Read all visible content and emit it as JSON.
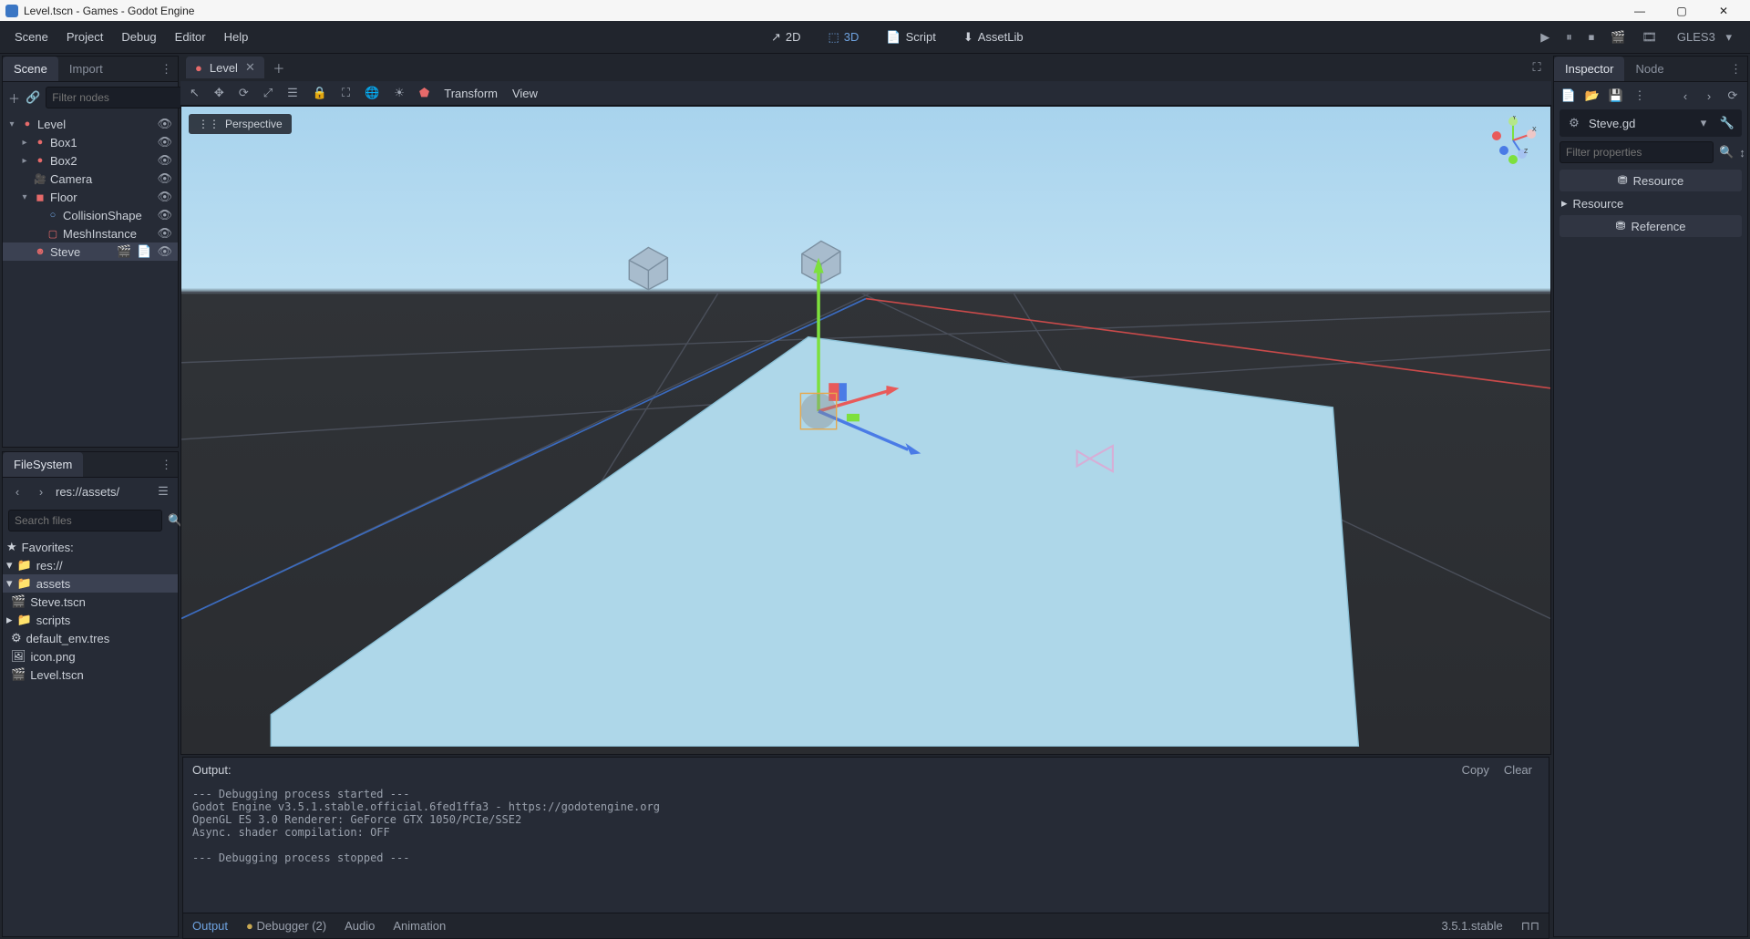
{
  "window": {
    "title": "Level.tscn - Games - Godot Engine"
  },
  "menubar": {
    "items": [
      "Scene",
      "Project",
      "Debug",
      "Editor",
      "Help"
    ],
    "modes": {
      "d2": "2D",
      "d3": "3D",
      "script": "Script",
      "assetlib": "AssetLib"
    },
    "renderer": "GLES3"
  },
  "scene_dock": {
    "tabs": [
      "Scene",
      "Import"
    ],
    "filter_placeholder": "Filter nodes",
    "tree": [
      {
        "label": "Level",
        "depth": 0,
        "icon": "●",
        "color": "nodecolor-red",
        "expand": "▾"
      },
      {
        "label": "Box1",
        "depth": 1,
        "icon": "●",
        "color": "nodecolor-red",
        "expand": "▸"
      },
      {
        "label": "Box2",
        "depth": 1,
        "icon": "●",
        "color": "nodecolor-red",
        "expand": "▸"
      },
      {
        "label": "Camera",
        "depth": 1,
        "icon": "🎥",
        "color": "nodecolor-scene",
        "expand": ""
      },
      {
        "label": "Floor",
        "depth": 1,
        "icon": "◼",
        "color": "nodecolor-red",
        "expand": "▾"
      },
      {
        "label": "CollisionShape",
        "depth": 2,
        "icon": "○",
        "color": "nodecolor-blue",
        "expand": ""
      },
      {
        "label": "MeshInstance",
        "depth": 2,
        "icon": "▢",
        "color": "nodecolor-scene",
        "expand": ""
      },
      {
        "label": "Steve",
        "depth": 1,
        "icon": "☻",
        "color": "nodecolor-scene",
        "expand": "",
        "selected": true,
        "extras": true
      }
    ]
  },
  "filesystem": {
    "title": "FileSystem",
    "path": "res://assets/",
    "search_placeholder": "Search files",
    "favorites": "Favorites:",
    "items": [
      {
        "label": "res://",
        "depth": 0,
        "icon": "folder",
        "expand": "▾"
      },
      {
        "label": "assets",
        "depth": 1,
        "icon": "folder",
        "expand": "▾",
        "selected": true
      },
      {
        "label": "Steve.tscn",
        "depth": 2,
        "icon": "scene",
        "expand": ""
      },
      {
        "label": "scripts",
        "depth": 1,
        "icon": "folder",
        "expand": "▸"
      },
      {
        "label": "default_env.tres",
        "depth": 1,
        "icon": "res",
        "expand": ""
      },
      {
        "label": "icon.png",
        "depth": 1,
        "icon": "img",
        "expand": ""
      },
      {
        "label": "Level.tscn",
        "depth": 1,
        "icon": "scene",
        "expand": ""
      }
    ]
  },
  "scene_tabs": {
    "current": "Level"
  },
  "viewport_toolbar": {
    "transform": "Transform",
    "view": "View",
    "perspective": "Perspective"
  },
  "bottom_panel": {
    "output_label": "Output:",
    "copy": "Copy",
    "clear": "Clear",
    "log": "--- Debugging process started ---\nGodot Engine v3.5.1.stable.official.6fed1ffa3 - https://godotengine.org\nOpenGL ES 3.0 Renderer: GeForce GTX 1050/PCIe/SSE2\nAsync. shader compilation: OFF\n \n--- Debugging process stopped ---",
    "tabs": {
      "output": "Output",
      "debugger": "Debugger (2)",
      "audio": "Audio",
      "animation": "Animation"
    },
    "version": "3.5.1.stable"
  },
  "inspector": {
    "tabs": [
      "Inspector",
      "Node"
    ],
    "object": "Steve.gd",
    "filter_placeholder": "Filter properties",
    "sections": {
      "resource_hdr": "Resource",
      "resource_sub": "Resource",
      "reference": "Reference"
    }
  }
}
